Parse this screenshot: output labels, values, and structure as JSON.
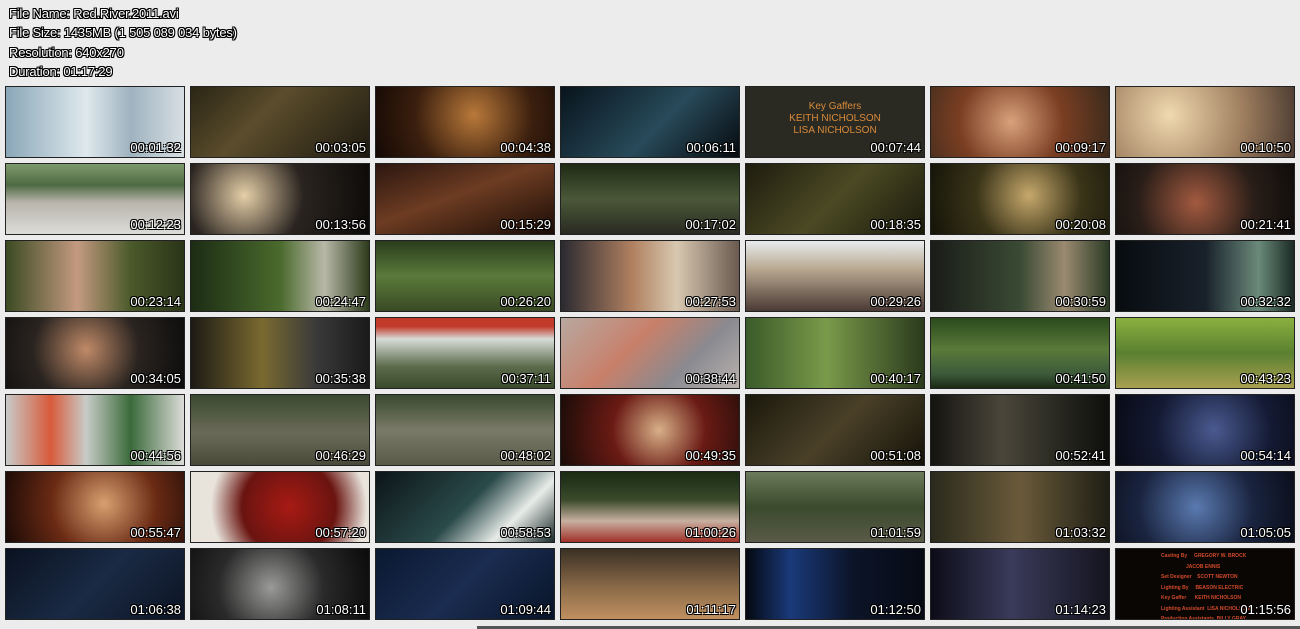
{
  "header": {
    "file_name": "File Name: Red.River.2011.avi",
    "file_size": "File Size: 1435MB (1 505 089 034 bytes)",
    "resolution": "Resolution: 640x270",
    "duration": "Duration: 01:17:29"
  },
  "thumbnails": [
    {
      "time": "00:01:32",
      "bg": "linear-gradient(90deg,#8aa7b8,#dfe9ee 45%,#9fb2bf 70%,#d7dfe3)"
    },
    {
      "time": "00:03:05",
      "bg": "linear-gradient(135deg,#2a2514,#5b4d2c 40%,#1e1a10)"
    },
    {
      "time": "00:04:38",
      "bg": "radial-gradient(circle at 55% 40%,#b9793a,#3b1f0e 55%,#140904)"
    },
    {
      "time": "00:06:11",
      "bg": "linear-gradient(135deg,#08141c,#284a5a 55%,#060a0e)"
    },
    {
      "time": "00:07:44",
      "bg": "#2a2a22",
      "caption": "Key Gaffers\nKEITH NICHOLSON\nLISA NICHOLSON"
    },
    {
      "time": "00:09:17",
      "bg": "radial-gradient(circle at 45% 50%,#d9a27c,#7a3e22 50%,#3a2a1c)"
    },
    {
      "time": "00:10:50",
      "bg": "radial-gradient(circle at 30% 40%,#f0d9b0,#a08060 55%,#4a3a30)"
    },
    {
      "time": "00:12:23",
      "bg": "linear-gradient(180deg,#7e9a6c,#4e6a42 30%,#b9b5ad 55%,#dcdcd8)"
    },
    {
      "time": "00:13:56",
      "bg": "radial-gradient(circle at 30% 45%,#e6cfa8,#2a2420 45%,#0c0a08)"
    },
    {
      "time": "00:15:29",
      "bg": "linear-gradient(160deg,#2c1610,#6d3c22 45%,#1a0c06)"
    },
    {
      "time": "00:17:02",
      "bg": "linear-gradient(180deg,#1f2a14,#4a5838 50%,#2a2a22)"
    },
    {
      "time": "00:18:35",
      "bg": "linear-gradient(135deg,#1e1c0e,#4b4a24 50%,#1a1a0c)"
    },
    {
      "time": "00:20:08",
      "bg": "radial-gradient(circle at 55% 45%,#c6a86c,#3a3418 50%,#141408)"
    },
    {
      "time": "00:21:41",
      "bg": "radial-gradient(circle at 45% 55%,#a35a40,#2a1e18 55%,#0e0c0a)"
    },
    {
      "time": "00:23:14",
      "bg": "linear-gradient(90deg,#3a4a22,#c49a80 40%,#4a5a2a 70%,#2a3418)"
    },
    {
      "time": "00:24:47",
      "bg": "linear-gradient(90deg,#1c2c14,#4a6a2c 50%,#b8b8a8 75%,#2c3a1a)"
    },
    {
      "time": "00:26:20",
      "bg": "linear-gradient(180deg,#2a3c1c,#5a7a3a 50%,#3a4a24)"
    },
    {
      "time": "00:27:53",
      "bg": "linear-gradient(90deg,#2a2a30,#b08060 40%,#d8c8b0 65%,#6a5a50)"
    },
    {
      "time": "00:29:26",
      "bg": "linear-gradient(180deg,#e8ecee,#b8a890 40%,#4a3a34)"
    },
    {
      "time": "00:30:59",
      "bg": "linear-gradient(90deg,#1a1c18,#3a4a34 50%,#9a8a70 75%,#2a3a24)"
    },
    {
      "time": "00:32:32",
      "bg": "linear-gradient(90deg,#080c10,#18202a 50%,#6a8a7a 80%,#1a2a24)"
    },
    {
      "time": "00:34:05",
      "bg": "radial-gradient(circle at 45% 45%,#c08a68,#2a2420 50%,#0c0c0c)"
    },
    {
      "time": "00:35:38",
      "bg": "linear-gradient(90deg,#1c1a14,#7a6a30 40%,#3a3a3a 70%,#1a1a1a)"
    },
    {
      "time": "00:37:11",
      "bg": "linear-gradient(180deg,#c23a2a 0%,#c23a2a 12%,#d8dcd8 30%,#5a6a4a 70%,#3a4a2c)"
    },
    {
      "time": "00:38:44",
      "bg": "linear-gradient(135deg,#b8a8a0,#c8806a 40%,#8a8a90 70%,#bab2ae)"
    },
    {
      "time": "00:40:17",
      "bg": "linear-gradient(90deg,#3a5a2a,#7a9a4a 45%,#2a3a1c)"
    },
    {
      "time": "00:41:50",
      "bg": "linear-gradient(180deg,#2a4a1c,#5a7a3a 45%,#3c5a3a 80%,#1a2a14)"
    },
    {
      "time": "00:43:23",
      "bg": "linear-gradient(180deg,#8ab040,#5a8030 50%,#a8a050)"
    },
    {
      "time": "00:44:56",
      "bg": "linear-gradient(90deg,#c8cac8,#d85a3a 25%,#c8ccc8 45%,#3a6a3a 70%,#dcdcd8)"
    },
    {
      "time": "00:46:29",
      "bg": "linear-gradient(180deg,#3a4a30,#6a6a58 55%,#4a4a3a)"
    },
    {
      "time": "00:48:02",
      "bg": "linear-gradient(180deg,#3a4a30,#7a7a68 50%,#5a5a48)"
    },
    {
      "time": "00:49:35",
      "bg": "radial-gradient(circle at 55% 50%,#d8b088,#6a1a14 45%,#1a0c08)"
    },
    {
      "time": "00:51:08",
      "bg": "linear-gradient(135deg,#1a180c,#4a4028 50%,#141208)"
    },
    {
      "time": "00:52:41",
      "bg": "linear-gradient(90deg,#141410,#4a463a 40%,#2a2a22 70%,#0e0e0c)"
    },
    {
      "time": "00:54:14",
      "bg": "radial-gradient(circle at 55% 50%,#4a5a90,#141a34 55%,#080a14)"
    },
    {
      "time": "00:55:47",
      "bg": "radial-gradient(circle at 55% 45%,#d8a070,#6a2a14 50%,#1a0a06)"
    },
    {
      "time": "00:57:20",
      "bg": "radial-gradient(circle at 55% 50%,#a81a14,#6a1410 45%,#e8e4dc 75%)"
    },
    {
      "time": "00:58:53",
      "bg": "linear-gradient(135deg,#0c1418,#2a4a4a 50%,#e8ece8 75%,#1a2a2a)"
    },
    {
      "time": "01:00:26",
      "bg": "linear-gradient(180deg,#1a2a14,#3a4a2a 40%,#c8b0a0 70%,#a03028)"
    },
    {
      "time": "01:01:59",
      "bg": "linear-gradient(180deg,#6a7a5a,#3a4a2c 50%,#5a5a48)"
    },
    {
      "time": "01:03:32",
      "bg": "linear-gradient(90deg,#2a2a1c,#6a5a3a 50%,#1e1e14)"
    },
    {
      "time": "01:05:05",
      "bg": "radial-gradient(circle at 45% 50%,#5a7ab0,#1a2440 55%,#0a0e1a)"
    },
    {
      "time": "01:06:38",
      "bg": "linear-gradient(135deg,#0a1220,#1a2a44 50%,#0c1424)"
    },
    {
      "time": "01:08:11",
      "bg": "radial-gradient(circle at 45% 55%,#9a9a98,#2a2a2a 50%,#0a0a0a)"
    },
    {
      "time": "01:09:44",
      "bg": "linear-gradient(135deg,#0a1830,#1a2c50 50%,#081428)"
    },
    {
      "time": "01:11:17",
      "bg": "linear-gradient(180deg,#3a3024,#8a6a48 55%,#c09060)"
    },
    {
      "time": "01:12:50",
      "bg": "linear-gradient(90deg,#040810,#1a3a7a 25%,#0c1428 60%,#060a14)"
    },
    {
      "time": "01:14:23",
      "bg": "linear-gradient(90deg,#0c0c18,#3a3a5a 45%,#14141e)"
    },
    {
      "time": "01:15:56",
      "bg": "#0a0604",
      "credits": "Casting By     GREGORY W. BROCK\n                  JACOB ENNIS\nSet Designer    SCOTT NEWTON\nLighting By     BEASON ELECTRIC\nKey Gaffer      KEITH NICHOLSON\nLighting Assistant  LISA NICHOLSON\nProduction Assistants  BILLY GRAY"
    }
  ]
}
